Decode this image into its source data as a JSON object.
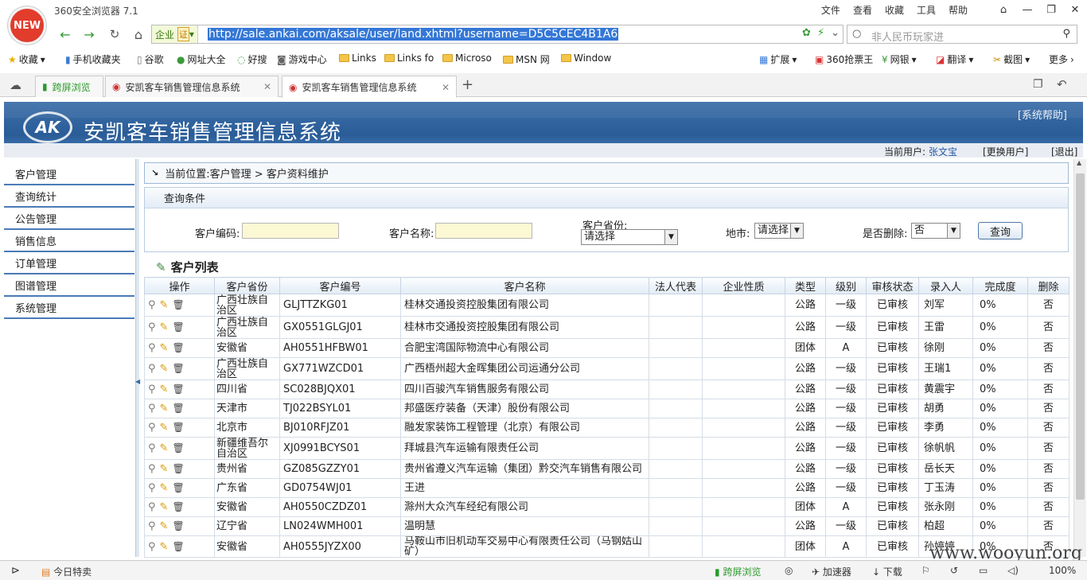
{
  "browser": {
    "title": "360安全浏览器 7.1",
    "logo_text": "NEW",
    "menu": [
      "文件",
      "查看",
      "收藏",
      "工具",
      "帮助"
    ],
    "corp_label": "企业",
    "cert_label": "证",
    "url": "http://sale.ankai.com/aksale/user/land.xhtml?username=D5C5CEC4B1A6",
    "search_placeholder": "非人民币玩家进",
    "bookmarks": [
      "收藏",
      "手机收藏夹",
      "谷歌",
      "网址大全",
      "好搜",
      "游戏中心",
      "Links",
      "Links fo",
      "Microso",
      "MSN 网",
      "Window"
    ],
    "bookmarks_right": [
      "扩展",
      "360抢票王",
      "网银",
      "翻译",
      "截图",
      "更多"
    ],
    "tabs": [
      {
        "label": "跨屏浏览"
      },
      {
        "label": "安凯客车销售管理信息系统"
      },
      {
        "label": "安凯客车销售管理信息系统"
      }
    ],
    "status": {
      "left": "今日特卖",
      "cross": "跨屏浏览",
      "accel": "加速器",
      "download": "下载",
      "zoom": "100%"
    }
  },
  "app": {
    "logo_text": "AK",
    "title": "安凯客车销售管理信息系统",
    "help": "[系统帮助]",
    "user_label": "当前用户:",
    "user_name": "张文宝",
    "change_user": "[更换用户]",
    "logout": "[退出]"
  },
  "menu": [
    "客户管理",
    "查询统计",
    "公告管理",
    "销售信息",
    "订单管理",
    "图谱管理",
    "系统管理"
  ],
  "breadcrumb": "当前位置:客户管理 > 客户资料维护",
  "query": {
    "title": "查询条件",
    "code_label": "客户编码:",
    "name_label": "客户名称:",
    "province_label": "客户省份:",
    "province_value": "请选择",
    "city_label": "地市:",
    "city_value": "请选择",
    "deleted_label": "是否删除:",
    "deleted_value": "否",
    "button": "查询"
  },
  "list_title": "客户列表",
  "table": {
    "headers": [
      "操作",
      "客户省份",
      "客户编号",
      "客户名称",
      "法人代表",
      "企业性质",
      "类型",
      "级别",
      "审核状态",
      "录入人",
      "完成度",
      "删除"
    ],
    "rows": [
      [
        "广西壮族自治区",
        "GLJTTZKG01",
        "桂林交通投资控股集团有限公司",
        "",
        "",
        "公路",
        "一级",
        "已审核",
        "刘军",
        "0%",
        "否"
      ],
      [
        "广西壮族自治区",
        "GX0551GLGJ01",
        "桂林市交通投资控股集团有限公司",
        "",
        "",
        "公路",
        "一级",
        "已审核",
        "王雷",
        "0%",
        "否"
      ],
      [
        "安徽省",
        "AH0551HFBW01",
        "合肥宝湾国际物流中心有限公司",
        "",
        "",
        "团体",
        "A",
        "已审核",
        "徐刚",
        "0%",
        "否"
      ],
      [
        "广西壮族自治区",
        "GX771WZCD01",
        "广西梧州超大金晖集团公司运通分公司",
        "",
        "",
        "公路",
        "一级",
        "已审核",
        "王瑞1",
        "0%",
        "否"
      ],
      [
        "四川省",
        "SC028BJQX01",
        "四川百骏汽车销售服务有限公司",
        "",
        "",
        "公路",
        "一级",
        "已审核",
        "黄震宇",
        "0%",
        "否"
      ],
      [
        "天津市",
        "TJ022BSYL01",
        "邦盛医疗装备（天津）股份有限公司",
        "",
        "",
        "公路",
        "一级",
        "已审核",
        "胡勇",
        "0%",
        "否"
      ],
      [
        "北京市",
        "BJ010RFJZ01",
        "融发家装饰工程管理（北京）有限公司",
        "",
        "",
        "公路",
        "一级",
        "已审核",
        "李勇",
        "0%",
        "否"
      ],
      [
        "新疆维吾尔自治区",
        "XJ0991BCYS01",
        "拜城县汽车运输有限责任公司",
        "",
        "",
        "公路",
        "一级",
        "已审核",
        "徐帆帆",
        "0%",
        "否"
      ],
      [
        "贵州省",
        "GZ085GZZY01",
        "贵州省遵义汽车运输（集团）黔交汽车销售有限公司",
        "",
        "",
        "公路",
        "一级",
        "已审核",
        "岳长天",
        "0%",
        "否"
      ],
      [
        "广东省",
        "GD0754WJ01",
        "王进",
        "",
        "",
        "公路",
        "一级",
        "已审核",
        "丁玉涛",
        "0%",
        "否"
      ],
      [
        "安徽省",
        "AH0550CZDZ01",
        "滁州大众汽车经纪有限公司",
        "",
        "",
        "团体",
        "A",
        "已审核",
        "张永刚",
        "0%",
        "否"
      ],
      [
        "辽宁省",
        "LN024WMH001",
        "温明慧",
        "",
        "",
        "公路",
        "一级",
        "已审核",
        "柏超",
        "0%",
        "否"
      ],
      [
        "安徽省",
        "AH0555JYZX00",
        "马鞍山市旧机动车交易中心有限责任公司（马钢姑山矿）",
        "",
        "",
        "团体",
        "A",
        "已审核",
        "孙婷婷",
        "0%",
        "否"
      ]
    ]
  },
  "watermark": "www.wooyun.org"
}
